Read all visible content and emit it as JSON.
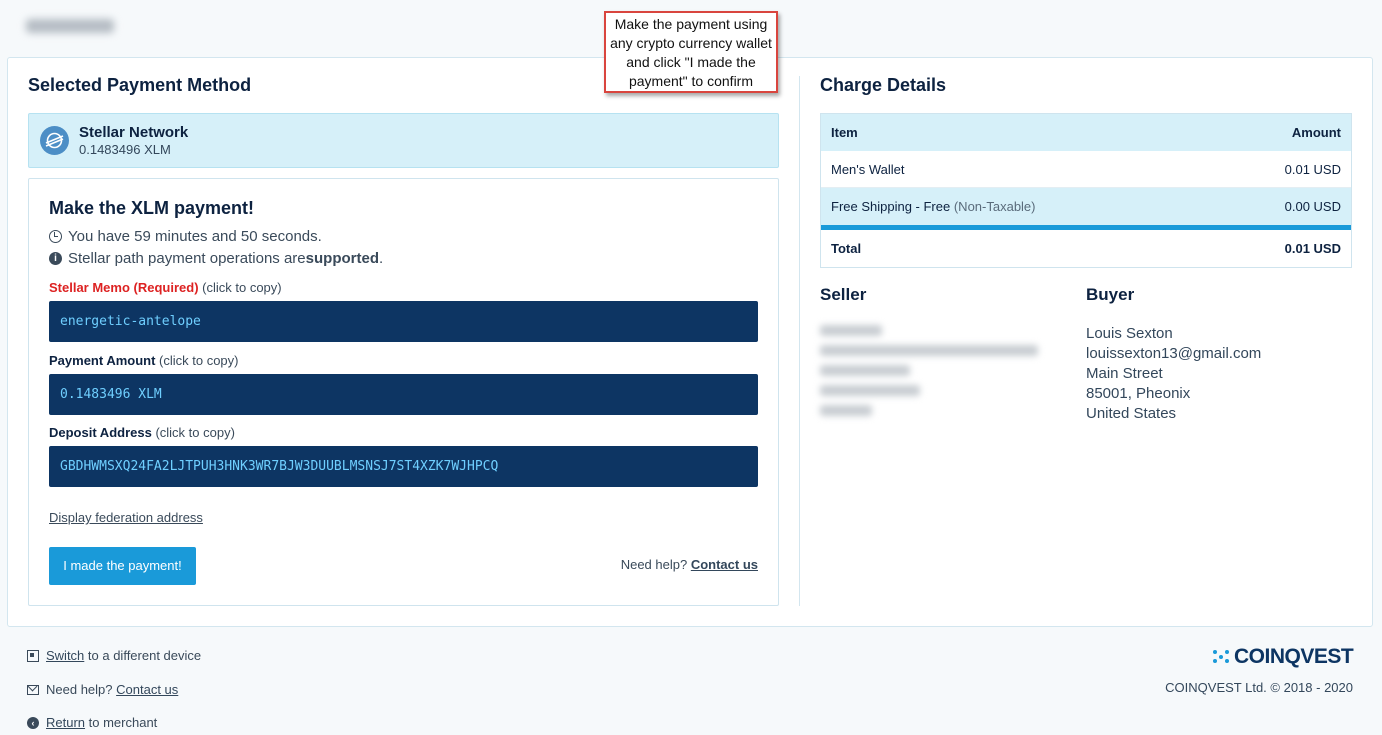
{
  "header": {
    "logo_text": "PayPorte"
  },
  "callout": {
    "text": "Make the payment using any crypto currency wallet and click \"I made the payment\" to confirm"
  },
  "left": {
    "title": "Selected Payment Method",
    "method": {
      "icon": "stellar-icon",
      "name": "Stellar Network",
      "amount": "0.1483496 XLM"
    },
    "payment": {
      "title": "Make the XLM payment!",
      "timer_text": "You have 59 minutes and 50 seconds.",
      "path_text_prefix": "Stellar path payment operations are ",
      "path_text_bold": "supported",
      "path_text_suffix": ".",
      "memo_label": "Stellar Memo (Required)",
      "memo_hint": " (click to copy)",
      "memo_value": "energetic-antelope",
      "amount_label": "Payment Amount",
      "amount_hint": " (click to copy)",
      "amount_value": "0.1483496 XLM",
      "address_label": "Deposit Address",
      "address_hint": " (click to copy)",
      "address_value": "GBDHWMSXQ24FA2LJTPUH3HNK3WR7BJW3DUUBLMSNSJ7ST4XZK7WJHPCQ",
      "federation_link": "Display federation address",
      "made_button": "I made the payment!",
      "help_prefix": "Need help? ",
      "help_link": "Contact us"
    }
  },
  "right": {
    "title": "Charge Details",
    "table": {
      "head_item": "Item",
      "head_amount": "Amount",
      "rows": [
        {
          "item": "Men's Wallet",
          "note": "",
          "amount": "0.01 USD"
        },
        {
          "item": "Free Shipping - Free",
          "note": " (Non-Taxable)",
          "amount": "0.00 USD"
        }
      ],
      "total_label": "Total",
      "total_value": "0.01 USD"
    },
    "seller_title": "Seller",
    "buyer_title": "Buyer",
    "buyer": {
      "name": "Louis Sexton",
      "email": "louissexton13@gmail.com",
      "street": "Main Street",
      "city": "85001, Pheonix",
      "country": "United States"
    }
  },
  "footer": {
    "switch_link": "Switch",
    "switch_suffix": " to a different device",
    "help_prefix": "Need help? ",
    "help_link": "Contact us",
    "return_link": "Return",
    "return_suffix": " to merchant",
    "brand": "COINQVEST",
    "copyright": "COINQVEST Ltd. © 2018 - 2020"
  }
}
